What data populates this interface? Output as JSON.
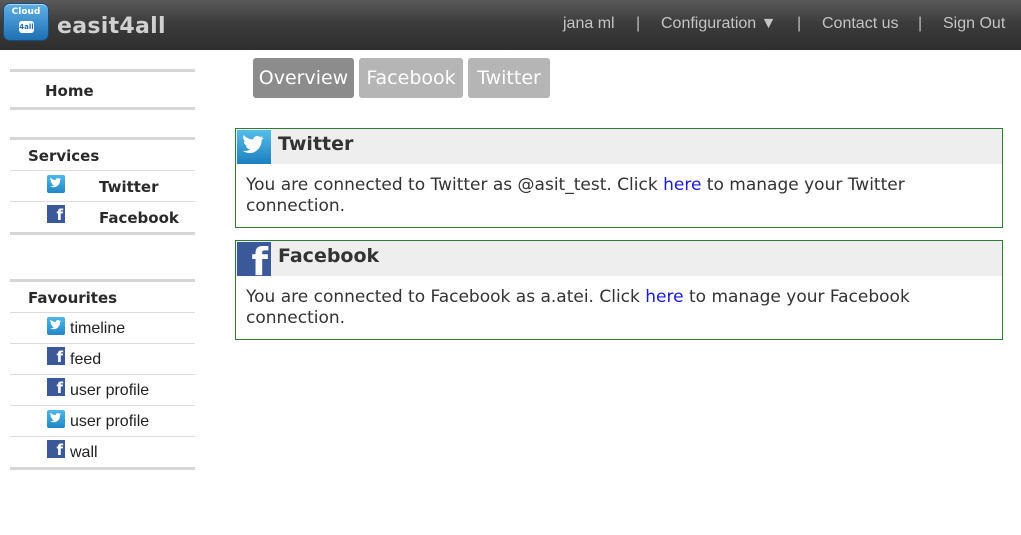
{
  "header": {
    "logo_text": "Cloud",
    "logo_badge": "4all",
    "brand": "easit4all",
    "nav": {
      "user": "jana ml",
      "configuration": "Configuration ▼",
      "contact": "Contact us",
      "signout": "Sign Out",
      "separator": "|"
    }
  },
  "sidebar": {
    "home": "Home",
    "services": {
      "heading": "Services",
      "items": [
        {
          "label": "Twitter",
          "icon": "twitter-icon"
        },
        {
          "label": "Facebook",
          "icon": "facebook-icon"
        }
      ]
    },
    "favourites": {
      "heading": "Favourites",
      "items": [
        {
          "label": "timeline",
          "icon": "twitter-icon"
        },
        {
          "label": "feed",
          "icon": "facebook-icon"
        },
        {
          "label": "user profile",
          "icon": "facebook-icon"
        },
        {
          "label": "user profile",
          "icon": "twitter-icon"
        },
        {
          "label": "wall",
          "icon": "facebook-icon"
        }
      ]
    }
  },
  "tabs": [
    {
      "label": "Overview",
      "active": true
    },
    {
      "label": "Facebook",
      "active": false
    },
    {
      "label": "Twitter",
      "active": false
    }
  ],
  "panels": {
    "twitter": {
      "title": "Twitter",
      "text_before": "You are connected to Twitter as @asit_test. Click ",
      "link": "here",
      "text_after": " to manage your Twitter connection."
    },
    "facebook": {
      "title": "Facebook",
      "text_before": "You are connected to Facebook as a.atei. Click ",
      "link": "here",
      "text_after": " to manage your Facebook connection."
    }
  },
  "colors": {
    "header_bg": "#3c3c3c",
    "tab_active": "#8c8c8c",
    "tab_inactive": "#b5b5b5",
    "panel_border": "#2e7d32",
    "link": "#1a1adb",
    "twitter_blue": "#2b8fd0",
    "facebook_blue": "#3b5998"
  }
}
